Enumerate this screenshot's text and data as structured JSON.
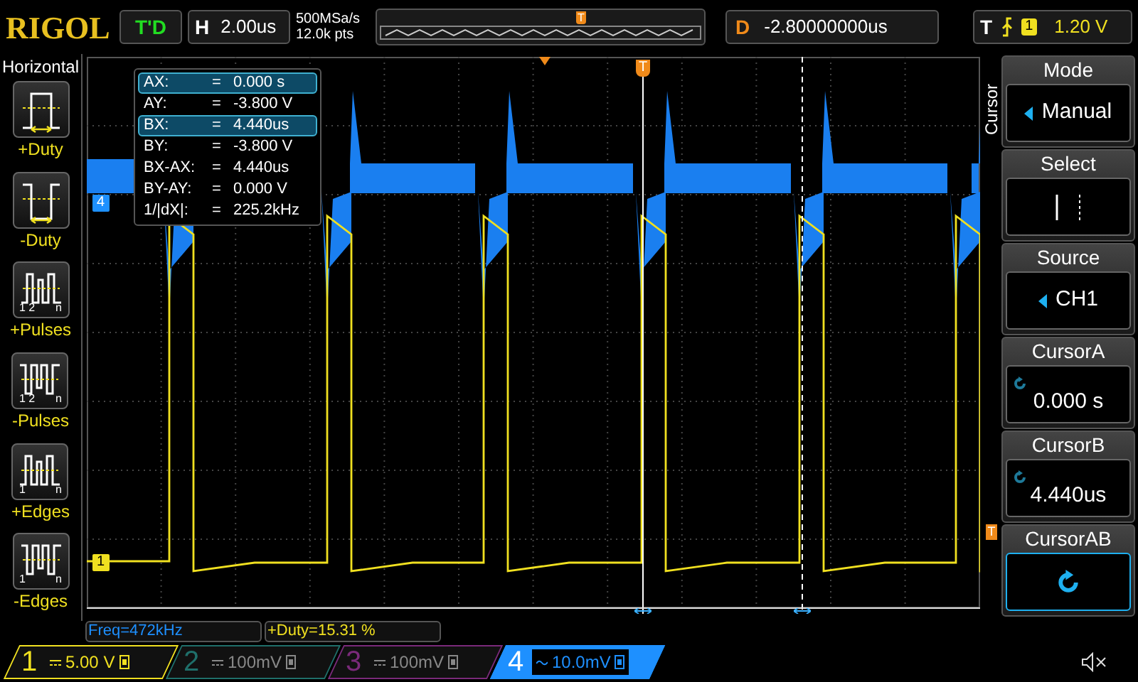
{
  "brand": "RIGOL",
  "run_status": "T'D",
  "timebase": {
    "label": "H",
    "value": "2.00us"
  },
  "acquisition": {
    "rate": "500MSa/s",
    "depth": "12.0k pts"
  },
  "overview": {
    "marker": "T"
  },
  "delay": {
    "label": "D",
    "value": "-2.80000000us"
  },
  "trigger": {
    "label": "T",
    "source": "1",
    "level": "1.20 V"
  },
  "left_menu": {
    "title": "Horizontal",
    "items": [
      {
        "label": "+Duty",
        "kind": "plus-duty"
      },
      {
        "label": "-Duty",
        "kind": "minus-duty"
      },
      {
        "label": "+Pulses",
        "kind": "plus-pulses",
        "marks": [
          "1 2",
          "n"
        ]
      },
      {
        "label": "-Pulses",
        "kind": "minus-pulses",
        "marks": [
          "1 2",
          "n"
        ]
      },
      {
        "label": "+Edges",
        "kind": "plus-edges",
        "marks": [
          "1",
          "n"
        ]
      },
      {
        "label": "-Edges",
        "kind": "minus-edges",
        "marks": [
          "1",
          "n"
        ]
      }
    ]
  },
  "cursor_table": [
    {
      "label": "AX:",
      "eq": "=",
      "value": "0.000 s",
      "selected": true
    },
    {
      "label": "AY:",
      "eq": "=",
      "value": "-3.800 V",
      "selected": false
    },
    {
      "label": "BX:",
      "eq": "=",
      "value": "4.440us",
      "selected": true
    },
    {
      "label": "BY:",
      "eq": "=",
      "value": "-3.800 V",
      "selected": false
    },
    {
      "label": "BX-AX:",
      "eq": "=",
      "value": "4.440us",
      "selected": false
    },
    {
      "label": "BY-AY:",
      "eq": "=",
      "value": "0.000 V",
      "selected": false
    },
    {
      "label": "1/|dX|:",
      "eq": "=",
      "value": "225.2kHz",
      "selected": false
    }
  ],
  "markers": {
    "channel_4": "4",
    "channel_1": "1",
    "trigger_cursor": "T",
    "trigger_level": "T"
  },
  "measurements": [
    {
      "text": "Freq=472kHz",
      "color": "#1e90ff"
    },
    {
      "text": "+Duty=15.31 %",
      "color": "#f0e020"
    }
  ],
  "channels": [
    {
      "number": "1",
      "kind": "dc",
      "scale": "5.00 V",
      "color": "#f0e020",
      "selected": false
    },
    {
      "number": "2",
      "kind": "dc",
      "scale": "100mV",
      "color": "#1f6f6a",
      "selected": false
    },
    {
      "number": "3",
      "kind": "dc",
      "scale": "100mV",
      "color": "#7a2a7a",
      "selected": false
    },
    {
      "number": "4",
      "kind": "ac",
      "scale": "10.0mV",
      "color": "#1e90ff",
      "selected": true
    }
  ],
  "right_menu": {
    "title": "Cursor",
    "items": [
      {
        "title": "Mode",
        "kind": "select",
        "value": "Manual"
      },
      {
        "title": "Select",
        "kind": "cursor-select"
      },
      {
        "title": "Source",
        "kind": "select",
        "value": "CH1"
      },
      {
        "title": "CursorA",
        "kind": "knob",
        "value": "0.000 s"
      },
      {
        "title": "CursorB",
        "kind": "knob",
        "value": "4.440us"
      },
      {
        "title": "CursorAB",
        "kind": "knob-button",
        "selected": true
      }
    ]
  },
  "sound": {
    "muted": true
  }
}
